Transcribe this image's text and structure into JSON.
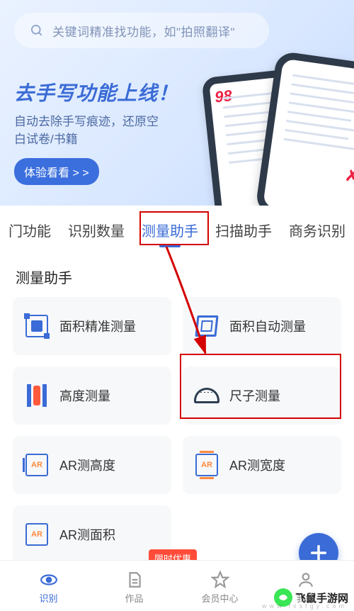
{
  "search": {
    "placeholder": "关键词精准找功能，如\"拍照翻译\""
  },
  "banner": {
    "title": "去手写功能上线！",
    "sub_line1": "自动去除手写痕迹，还原空",
    "sub_line2": "白试卷/书籍",
    "button": "体验看看 > >"
  },
  "tabs": [
    {
      "label": "门功能",
      "active": false
    },
    {
      "label": "识别数量",
      "active": false
    },
    {
      "label": "测量助手",
      "active": true
    },
    {
      "label": "扫描助手",
      "active": false
    },
    {
      "label": "商务识别",
      "active": false
    }
  ],
  "section_title": "测量助手",
  "cards": [
    {
      "label": "面积精准测量",
      "icon": "area-precise"
    },
    {
      "label": "面积自动测量",
      "icon": "area-auto"
    },
    {
      "label": "高度测量",
      "icon": "height"
    },
    {
      "label": "尺子测量",
      "icon": "ruler"
    },
    {
      "label": "AR测高度",
      "icon": "ar-height"
    },
    {
      "label": "AR测宽度",
      "icon": "ar-width"
    },
    {
      "label": "AR测面积",
      "icon": "ar-area"
    }
  ],
  "badge": "限时优惠",
  "nav": {
    "recognize": "识别",
    "works": "作品",
    "center": "会员中心",
    "mine": "我的"
  },
  "watermark": {
    "text": "飞鼠手游网",
    "url": "www.fsstgy.com"
  }
}
